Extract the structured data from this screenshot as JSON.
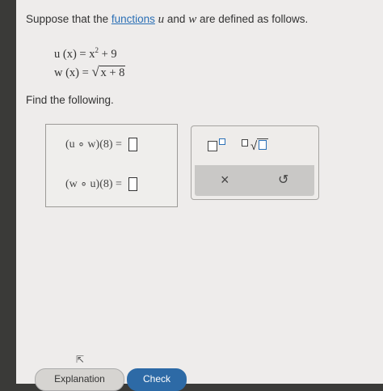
{
  "prompt": {
    "before": "Suppose that the ",
    "link": "functions",
    "var_u": "u",
    "and": " and ",
    "var_w": "w",
    "after": " are defined as follows."
  },
  "definitions": {
    "u_lhs": "u (x) = x",
    "u_exp": "2",
    "u_rest": " + 9",
    "w_lhs": "w (x) = ",
    "w_radicand": "x + 8"
  },
  "instruction": "Find the following.",
  "answers": [
    {
      "expr": "(u ∘ w)(8) =",
      "value": ""
    },
    {
      "expr": "(w ∘ u)(8) =",
      "value": ""
    }
  ],
  "toolbar": {
    "clear": "×",
    "undo": "↺"
  },
  "buttons": {
    "explanation": "Explanation",
    "check": "Check"
  }
}
